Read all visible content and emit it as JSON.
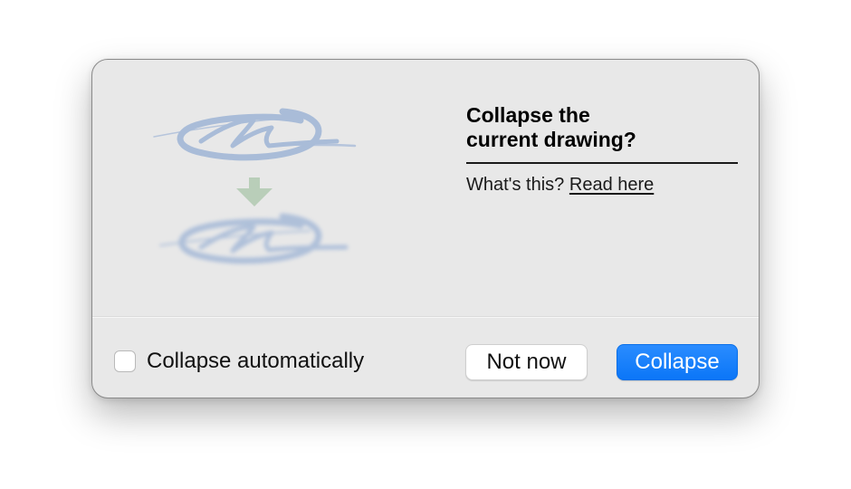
{
  "dialog": {
    "title_line1": "Collapse the",
    "title_line2": "current drawing?",
    "help_prefix": "What's this?",
    "help_link": "Read here",
    "illustration": {
      "icon": "collapse-drawing-illustration",
      "stroke_color": "#a9bcd8",
      "arrow_color": "#b9ceb9"
    },
    "checkbox": {
      "label": "Collapse automatically",
      "checked": false
    },
    "buttons": {
      "secondary": "Not now",
      "primary": "Collapse"
    },
    "accent_color": "#1580f8"
  }
}
